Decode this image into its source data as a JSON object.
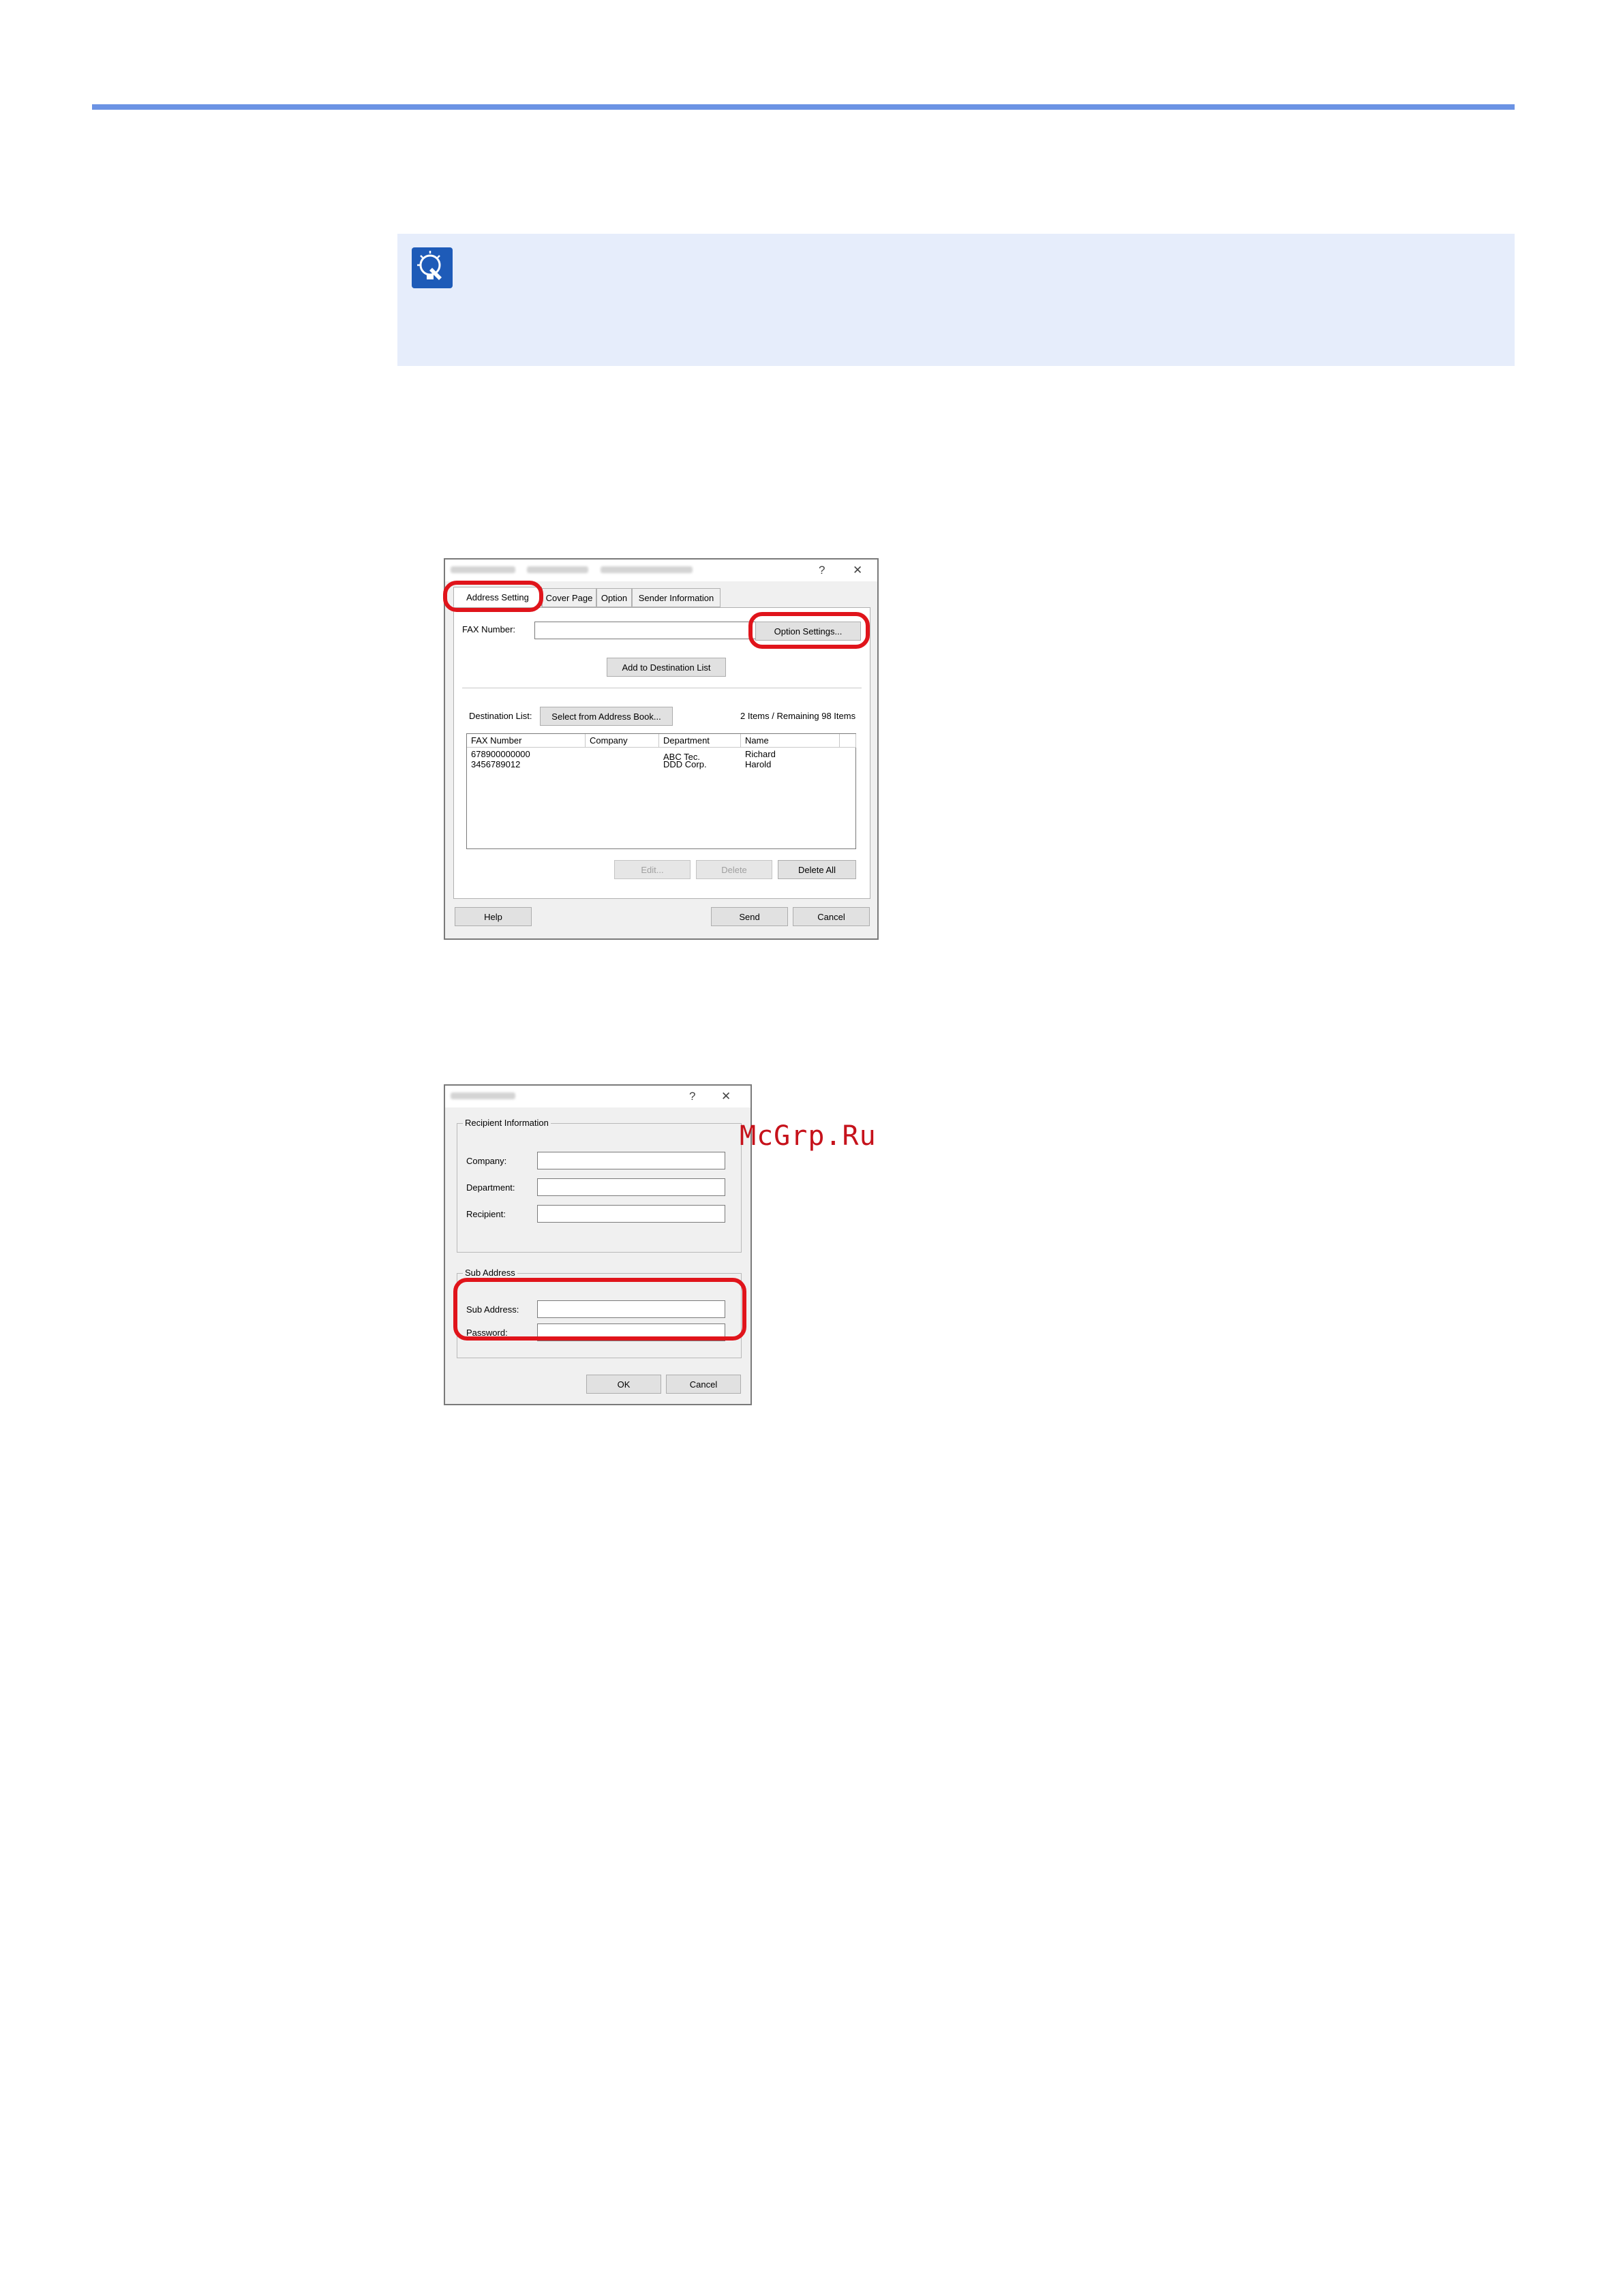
{
  "watermark": "McGrp.Ru",
  "fax_dialog": {
    "title_help": "?",
    "title_close": "✕",
    "tabs": [
      "Address Setting",
      "Cover Page",
      "Option",
      "Sender Information"
    ],
    "fax_number_label": "FAX Number:",
    "fax_number_value": "",
    "option_settings_label": "Option Settings...",
    "add_to_destination_label": "Add to Destination List",
    "destination_list_label": "Destination List:",
    "select_address_book_label": "Select from Address Book...",
    "items_status": "2 Items / Remaining 98 Items",
    "columns": [
      "FAX Number",
      "Company",
      "Department",
      "Name"
    ],
    "rows": [
      {
        "fax": "678900000000",
        "company": "",
        "department": "ABC Tec.",
        "name": "Richard"
      },
      {
        "fax": "3456789012",
        "company": "",
        "department": "DDD Corp.",
        "name": "Harold"
      }
    ],
    "edit_label": "Edit...",
    "delete_label": "Delete",
    "delete_all_label": "Delete All",
    "help_label": "Help",
    "send_label": "Send",
    "cancel_label": "Cancel"
  },
  "option_dialog": {
    "title_help": "?",
    "title_close": "✕",
    "recipient_group": "Recipient Information",
    "company_label": "Company:",
    "department_label": "Department:",
    "recipient_label": "Recipient:",
    "sub_address_group": "Sub Address",
    "sub_address_label": "Sub Address:",
    "password_label": "Password:",
    "ok_label": "OK",
    "cancel_label": "Cancel"
  },
  "colors": {
    "accent_line": "#6b93e4",
    "note_bg": "#e6edfb",
    "highlight": "#e0141b"
  }
}
